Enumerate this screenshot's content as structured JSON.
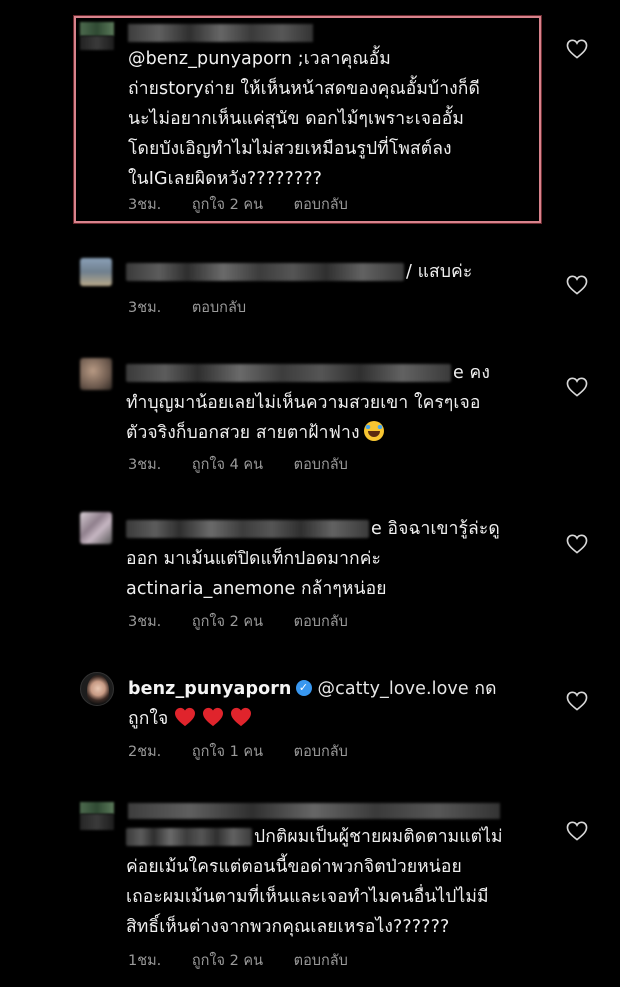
{
  "comments": [
    {
      "id": "c1",
      "text_lines": [
        "@benz_punyaporn ;เวลาคุณอั้ม",
        "ถ่ายstoryถ่าย ให้เห็นหน้าสดของคุณอั้มบ้างก็ดี",
        "นะไม่อยากเห็นแค่สุนัข ดอกไม้ๆเพราะเจออั้ม",
        "โดยบังเอิญทำไมไม่สวยเหมือนรูปที่โพสต์ลง",
        "ในIGเลยผิดหวัง????????"
      ],
      "time": "3ชม.",
      "likes": "ถูกใจ 2 คน",
      "reply": "ตอบกลับ"
    },
    {
      "id": "c2",
      "text_lines": [
        "/ แสบค่ะ"
      ],
      "time": "3ชม.",
      "reply": "ตอบกลับ"
    },
    {
      "id": "c3",
      "text_lines": [
        "e คง",
        "ทำบุญมาน้อยเลยไม่เห็นความสวยเขา ใครๆเจอ",
        "ตัวจริงก็บอกสวย สายตาฝ้าฟาง"
      ],
      "time": "3ชม.",
      "likes": "ถูกใจ 4 คน",
      "reply": "ตอบกลับ"
    },
    {
      "id": "c4",
      "text_lines": [
        "e อิจฉาเขารู้ล่ะดู",
        "ออก มาเม้นแต่ปิดแท็กปอดมากค่ะ",
        "actinaria_anemone กล้าๆหน่อย"
      ],
      "time": "3ชม.",
      "likes": "ถูกใจ 2 คน",
      "reply": "ตอบกลับ"
    },
    {
      "id": "c5",
      "username": "benz_punyaporn",
      "verified_mark": "✓",
      "mention": "@catty_love.love",
      "text_after": "กด",
      "line2": "ถูกใจ",
      "time": "2ชม.",
      "likes": "ถูกใจ 1 คน",
      "reply": "ตอบกลับ"
    },
    {
      "id": "c6",
      "text_lines": [
        "ปกติผมเป็นผู้ชายผมติดตามแต่ไม่",
        "ค่อยเม้นใครแต่ตอนนี้ขอด่าพวกจิตป่วยหน่อย",
        "เถอะผมเม้นตามที่เห็นและเจอทำไมคนอื่นไปไม่มี",
        "สิทธิ์เห็นต่างจากพวกคุณเลยเหรอไง??????"
      ],
      "time": "1ชม.",
      "likes": "ถูกใจ 2 คน",
      "reply": "ตอบกลับ"
    }
  ],
  "colors": {
    "background": "#000000",
    "highlight_border": "#d8838c",
    "verified": "#3897f0",
    "heart_red": "#e0242c"
  },
  "icons": {
    "like": "heart-outline-icon",
    "verified": "verified-badge-icon",
    "emoji": "laughing-tears-emoji",
    "red_heart": "red-heart-emoji"
  }
}
